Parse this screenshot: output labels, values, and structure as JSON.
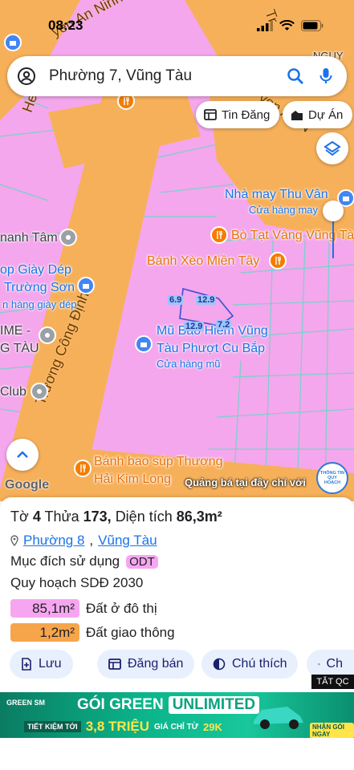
{
  "status_bar": {
    "time": "08:23"
  },
  "search": {
    "query": "Phường 7, Vũng Tàu"
  },
  "chips": {
    "tin_dang": "Tin Đăng",
    "du_an": "Dự Án"
  },
  "map": {
    "streets": {
      "top_left": "yen An Ninh",
      "top_right_a": "Tr",
      "top_right_b": "yen An N",
      "diagonal": "Trương Công Định",
      "top_left_h": "He"
    },
    "pois": {
      "nha_may": "Nhà may Thu Vân",
      "nha_may_sub": "Cửa hàng may",
      "bo_tai": "Bò Tạt Vàng Vũng Tà",
      "banh_xeo": "Bánh Xèo Miền Tây",
      "mu_bao_hiem_1": "Mũ Bảo Hiểm Vũng",
      "mu_bao_hiem_2": "Tàu Phượt Cu Bắp",
      "mu_bao_hiem_sub": "Cửa hàng mũ",
      "giay_dep_1": "op Giày Dép",
      "giay_dep_2": "Trường Sơn",
      "giay_dep_sub": "n hàng giày dép",
      "manh_tam": "nanh Tâm",
      "ime_1": "IME -",
      "ime_2": "G TÀU",
      "club": "Club",
      "banh_bao_1": "Bánh bao súp Thượng",
      "banh_bao_2": "Hải Kim Long",
      "nguy": "NGUY"
    },
    "parcel_labels": {
      "left": "6.9",
      "top": "12.9",
      "bottom_left": "12.9",
      "bottom_right": "7.2"
    },
    "google": "Google",
    "promo": "Quảng bá tại đây chỉ với",
    "tt_badge": "THÔNG TIN QUY HOẠCH"
  },
  "sheet": {
    "to_label": "Tờ",
    "to_value": "4",
    "thua_label": "Thửa",
    "thua_value": "173,",
    "dt_label": "Diện tích",
    "dt_value": "86,3m²",
    "ward": "Phường 8",
    "sep": ",",
    "city": "Vũng Tàu",
    "muc_dich_label": "Mục đích sử dụng",
    "muc_dich_value": "ODT",
    "quy_hoach": "Quy hoạch SDĐ 2030",
    "areas": [
      {
        "value": "85,1m²",
        "label": "Đất ở đô thị",
        "color": "#f6a6f0"
      },
      {
        "value": "1,2m²",
        "label": "Đất giao thông",
        "color": "#f7a54b"
      }
    ],
    "buttons": {
      "luu": "Lưu",
      "dang_ban": "Đăng bán",
      "chu_thich": "Chú thích",
      "ch": "Ch"
    }
  },
  "ad": {
    "tatqc": "TẮT QC",
    "brand": "GREEN SM",
    "headline_a": "GÓI GREEN",
    "headline_b": "UNLIMITED",
    "sub_a": "TIẾT KIỆM TỚI",
    "sub_b": "3,8 TRIỆU",
    "sub_c": "GIÁ CHỈ TỪ",
    "sub_d": "29K",
    "cta": "NHẬN GÓI NGAY"
  },
  "colors": {
    "pink": "#f4a7ec",
    "road": "#f7b05a",
    "accent": "#1a73e8"
  }
}
